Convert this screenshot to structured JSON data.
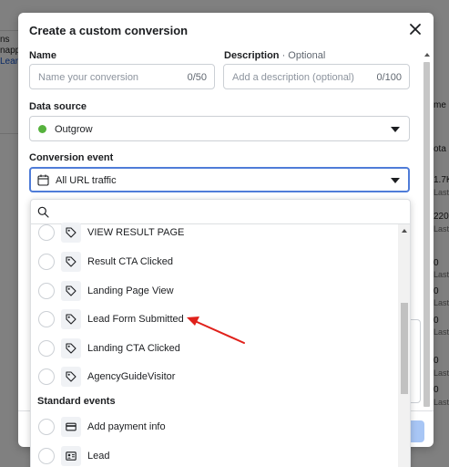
{
  "background": {
    "left_lines": [
      "ns",
      "napp",
      "Lear"
    ],
    "right_lines": [
      {
        "text": "me",
        "sub": false
      },
      {
        "text": "ota",
        "sub": false
      },
      {
        "text": "1.7K",
        "sub": false
      },
      {
        "text": "Last",
        "sub": true
      },
      {
        "text": "220",
        "sub": false
      },
      {
        "text": "Last",
        "sub": true
      },
      {
        "text": "0",
        "sub": false
      },
      {
        "text": "Last",
        "sub": true
      },
      {
        "text": "0",
        "sub": false
      },
      {
        "text": "Last",
        "sub": true
      },
      {
        "text": "0",
        "sub": false
      },
      {
        "text": "Last",
        "sub": true
      },
      {
        "text": "0",
        "sub": false
      },
      {
        "text": "Last",
        "sub": true
      },
      {
        "text": "0",
        "sub": false
      },
      {
        "text": "Last",
        "sub": true
      }
    ]
  },
  "modal": {
    "title": "Create a custom conversion",
    "name_field": {
      "label": "Name",
      "placeholder": "Name your conversion",
      "counter": "0/50"
    },
    "description_field": {
      "label": "Description",
      "optional": " · Optional",
      "placeholder": "Add a description (optional)",
      "counter": "0/100"
    },
    "data_source": {
      "label": "Data source",
      "value": "Outgrow",
      "status_color": "#56b23d"
    },
    "conversion_event": {
      "label": "Conversion event",
      "value": "All URL traffic"
    }
  },
  "dropdown": {
    "search_placeholder": "",
    "custom_events": [
      {
        "label": "VIEW RESULT PAGE",
        "icon": "tag-icon"
      },
      {
        "label": "Result CTA Clicked",
        "icon": "tag-icon"
      },
      {
        "label": "Landing Page View",
        "icon": "tag-icon"
      },
      {
        "label": "Lead Form Submitted",
        "icon": "tag-icon"
      },
      {
        "label": "Landing CTA Clicked",
        "icon": "tag-icon"
      },
      {
        "label": "AgencyGuideVisitor",
        "icon": "tag-icon"
      }
    ],
    "standard_heading": "Standard events",
    "standard_events": [
      {
        "label": "Add payment info",
        "icon": "credit-card-icon"
      },
      {
        "label": "Lead",
        "icon": "id-card-icon"
      }
    ]
  },
  "annotation": {
    "color": "#e0211b",
    "points_to": "Lead Form Submitted"
  },
  "colors": {
    "accent": "#4f7cd8",
    "primary_button_disabled": "#a8c6f5"
  }
}
